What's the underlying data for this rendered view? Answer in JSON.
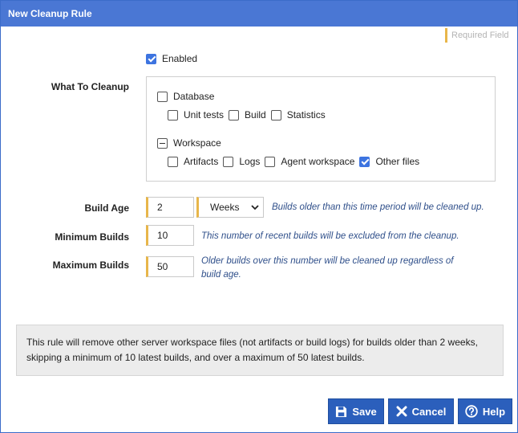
{
  "dialog": {
    "title": "New Cleanup Rule"
  },
  "required_field_label": "Required Field",
  "enabled": {
    "label": "Enabled",
    "checked": true
  },
  "what_to_cleanup": {
    "label": "What To Cleanup",
    "database": {
      "label": "Database",
      "state": "unchecked",
      "items": [
        {
          "label": "Unit tests",
          "checked": false
        },
        {
          "label": "Build",
          "checked": false
        },
        {
          "label": "Statistics",
          "checked": false
        }
      ]
    },
    "workspace": {
      "label": "Workspace",
      "state": "indeterminate",
      "items": [
        {
          "label": "Artifacts",
          "checked": false
        },
        {
          "label": "Logs",
          "checked": false
        },
        {
          "label": "Agent workspace",
          "checked": false
        },
        {
          "label": "Other files",
          "checked": true
        }
      ]
    }
  },
  "build_age": {
    "label": "Build Age",
    "value": "2",
    "unit": "Weeks",
    "hint": "Builds older than this time period will be cleaned up."
  },
  "minimum_builds": {
    "label": "Minimum Builds",
    "value": "10",
    "hint": "This number of recent builds will be excluded from the cleanup."
  },
  "maximum_builds": {
    "label": "Maximum Builds",
    "value": "50",
    "hint_line1": "Older builds over this number will be cleaned up regardless of",
    "hint_line2": "build age."
  },
  "summary": {
    "line1": "This rule will remove other server workspace files (not artifacts or build logs) for builds older than 2 weeks,",
    "line2": "skipping a minimum of 10 latest builds, and over a maximum of 50 latest builds."
  },
  "buttons": {
    "save": "Save",
    "cancel": "Cancel",
    "help": "Help"
  },
  "colors": {
    "title_bar": "#4a77d4",
    "button": "#2b5fbc",
    "required_marker": "#e8b64a",
    "hint_text": "#2f4f8a"
  }
}
